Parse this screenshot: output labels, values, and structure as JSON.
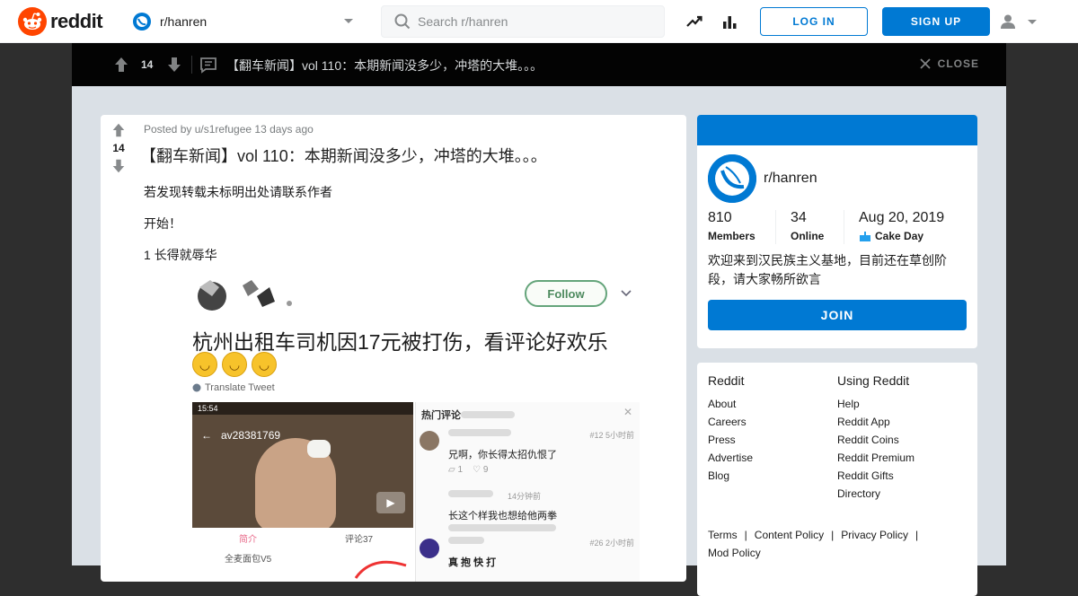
{
  "header": {
    "wordmark": "reddit",
    "community": "r/hanren",
    "search_placeholder": "Search r/hanren",
    "login_label": "LOG IN",
    "signup_label": "SIGN UP",
    "icons": [
      "reddit-logo-icon",
      "community-icon",
      "chevron-down-icon",
      "search-icon",
      "trending-icon",
      "stats-icon",
      "user-icon",
      "chevron-down-icon"
    ]
  },
  "postbar": {
    "votes": "14",
    "title": "【翻车新闻】vol 110：本期新闻没多少，冲塔的大堆。。。",
    "close_label": "CLOSE"
  },
  "post": {
    "votes": "14",
    "meta": "Posted by u/s1refugee 13 days ago",
    "title": "【翻车新闻】vol 110：本期新闻没多少，冲塔的大堆。。。",
    "paragraphs": [
      "若发现转载未标明出处请联系作者",
      "开始！",
      "1 长得就辱华"
    ],
    "embed": {
      "follow_label": "Follow",
      "headline": "杭州出租车司机因17元被打伤，看评论好欢乐",
      "translate": "Translate Tweet",
      "video_time": "15:54",
      "video_id": "av28381769",
      "video_tab_intro": "简介",
      "video_tab_comments": "评论37",
      "video_user": "全麦面包V5",
      "comments_head": "热门评论",
      "comments": [
        {
          "text": "兄啊，你长得太招仇恨了",
          "meta": "#12  5小时前",
          "likes": "1",
          "replies": "9"
        },
        {
          "text": "长这个样我也想给他两拳",
          "meta": "14分钟前"
        },
        {
          "text": "真 抱 快 打",
          "meta": "#26  2小时前"
        }
      ]
    }
  },
  "sidebar": {
    "community": "r/hanren",
    "members": "810",
    "members_label": "Members",
    "online": "34",
    "online_label": "Online",
    "cake_date": "Aug 20, 2019",
    "cake_label": "Cake Day",
    "description": "欢迎来到汉民族主义基地，目前还在草创阶段，请大家畅所欲言",
    "join_label": "JOIN"
  },
  "links": {
    "reddit_head": "Reddit",
    "reddit": [
      "About",
      "Careers",
      "Press",
      "Advertise",
      "Blog"
    ],
    "using_head": "Using Reddit",
    "using": [
      "Help",
      "Reddit App",
      "Reddit Coins",
      "Reddit Premium",
      "Reddit Gifts",
      "Directory"
    ],
    "legal": [
      "Terms",
      "Content Policy",
      "Privacy Policy",
      "Mod Policy"
    ]
  },
  "colors": {
    "brand_orange": "#ff4500",
    "accent_blue": "#0079d3",
    "canvas": "#dae0e6",
    "postbar": "#030303"
  }
}
